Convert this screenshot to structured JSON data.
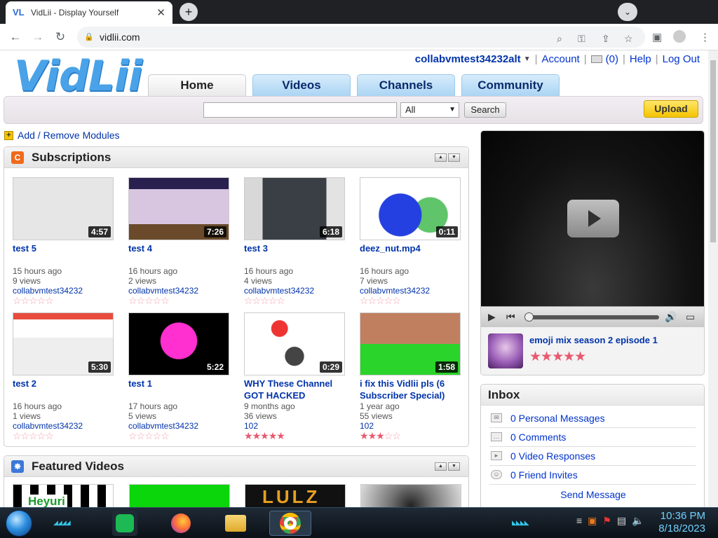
{
  "browser": {
    "tab_title": "VidLii - Display Yourself",
    "tab_favicon": "VL",
    "url": "vidlii.com"
  },
  "site": {
    "logo": "VidLii",
    "username": "collabvmtest34232alt",
    "account_label": "Account",
    "mail_count": "(0)",
    "help_label": "Help",
    "logout_label": "Log Out",
    "nav_tabs": [
      {
        "label": "Home",
        "active": true
      },
      {
        "label": "Videos",
        "active": false
      },
      {
        "label": "Channels",
        "active": false
      },
      {
        "label": "Community",
        "active": false
      }
    ],
    "search": {
      "value": "",
      "category": "All",
      "button_label": "Search"
    },
    "upload_label": "Upload",
    "add_modules_label": "Add / Remove Modules"
  },
  "subscriptions": {
    "title": "Subscriptions",
    "videos": [
      {
        "title": "test 5",
        "duration": "4:57",
        "age": "15 hours ago",
        "views": "9 views",
        "user": "collabvmtest34232",
        "rating": 0,
        "thumb": "placeholder"
      },
      {
        "title": "test 4",
        "duration": "7:26",
        "age": "16 hours ago",
        "views": "2 views",
        "user": "collabvmtest34232",
        "rating": 0,
        "thumb": "animation"
      },
      {
        "title": "test 3",
        "duration": "6:18",
        "age": "16 hours ago",
        "views": "4 views",
        "user": "collabvmtest34232",
        "rating": 0,
        "thumb": "screen"
      },
      {
        "title": "deez_nut.mp4",
        "duration": "0:11",
        "age": "16 hours ago",
        "views": "7 views",
        "user": "collabvmtest34232",
        "rating": 0,
        "thumb": "scribble"
      },
      {
        "title": "test 2",
        "duration": "5:30",
        "age": "16 hours ago",
        "views": "1 views",
        "user": "collabvmtest34232",
        "rating": 0,
        "thumb": "webpage"
      },
      {
        "title": "test 1",
        "duration": "5:22",
        "age": "17 hours ago",
        "views": "5 views",
        "user": "collabvmtest34232",
        "rating": 0,
        "thumb": "magenta"
      },
      {
        "title": "WHY These Channel GOT HACKED",
        "duration": "0:29",
        "age": "9 months ago",
        "views": "36 views",
        "user": "102",
        "rating": 5,
        "thumb": "drawing"
      },
      {
        "title": "i fix this Vidlii pls (6 Subscriber Special)",
        "duration": "1:58",
        "age": "1 year ago",
        "views": "55 views",
        "user": "102",
        "rating": 3,
        "thumb": "game"
      }
    ]
  },
  "featured": {
    "title": "Featured Videos",
    "thumbs": [
      "Heyuri",
      "green",
      "LULZ",
      "face"
    ]
  },
  "player": {
    "title": "emoji mix season 2 episode 1",
    "rating": 5
  },
  "inbox": {
    "title": "Inbox",
    "items": [
      {
        "label": "0 Personal Messages",
        "icon": "envelope-icon"
      },
      {
        "label": "0 Comments",
        "icon": "comment-icon"
      },
      {
        "label": "0 Video Responses",
        "icon": "video-response-icon"
      },
      {
        "label": "0 Friend Invites",
        "icon": "friend-icon"
      }
    ],
    "send_label": "Send Message"
  },
  "taskbar": {
    "time": "10:36 PM",
    "date": "8/18/2023"
  },
  "colors": {
    "accent_blue": "#0033aa",
    "logo_blue": "#4aa3e8",
    "star_red": "#e8596f",
    "upload_yellow": "#f4c400"
  }
}
